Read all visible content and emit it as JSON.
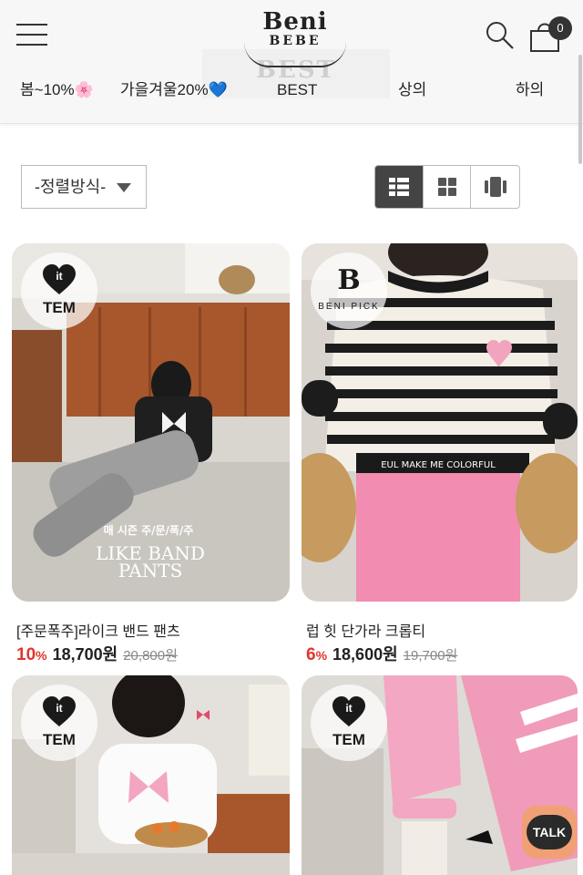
{
  "header": {
    "logo_line1": "Beni",
    "logo_line2": "BEBE",
    "cart_count": "0",
    "watermark": "BEST"
  },
  "nav": [
    {
      "label": "봄~10%🌸"
    },
    {
      "label": "가을겨울20%💙"
    },
    {
      "label": "BEST"
    },
    {
      "label": "상의"
    },
    {
      "label": "하의"
    }
  ],
  "toolbar": {
    "sort_label": "-정렬방식-",
    "views": [
      "large-grid-view",
      "grid-view",
      "slide-view"
    ],
    "active_view": 0
  },
  "products": [
    {
      "name": "[주문폭주]라이크 밴드 팬츠",
      "discount": "10",
      "pct": "%",
      "price": "18,700원",
      "original": "20,800원",
      "badge_top": "it",
      "badge_bottom": "TEM",
      "overlay_small": "매 시즌 주/문/폭/주",
      "overlay_big1": "LIKE BAND",
      "overlay_big2": "PANTS"
    },
    {
      "name": "럽 힛 단가라 크롭티",
      "discount": "6",
      "pct": "%",
      "price": "18,600원",
      "original": "19,700원",
      "badge_top": "B",
      "badge_bottom": "BENI PICK",
      "overlay_small": "",
      "overlay_big1": "",
      "overlay_big2": ""
    },
    {
      "badge_top": "it",
      "badge_bottom": "TEM"
    },
    {
      "badge_top": "it",
      "badge_bottom": "TEM"
    }
  ],
  "talk_label": "TALK",
  "colors": {
    "discount": "#e0352b",
    "talk_bg": "#f1a075",
    "active_view": "#444444"
  }
}
